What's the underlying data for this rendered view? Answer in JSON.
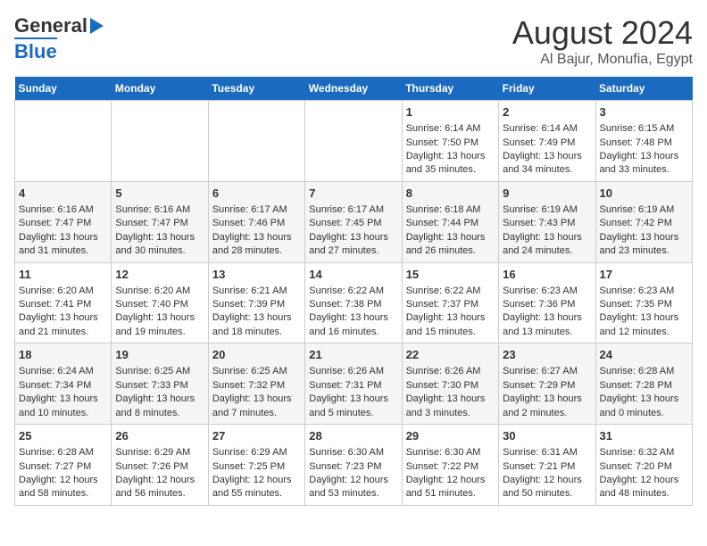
{
  "header": {
    "logo_line1": "General",
    "logo_line2": "Blue",
    "title": "August 2024",
    "subtitle": "Al Bajur, Monufia, Egypt"
  },
  "days_of_week": [
    "Sunday",
    "Monday",
    "Tuesday",
    "Wednesday",
    "Thursday",
    "Friday",
    "Saturday"
  ],
  "weeks": [
    [
      {
        "day": "",
        "info": ""
      },
      {
        "day": "",
        "info": ""
      },
      {
        "day": "",
        "info": ""
      },
      {
        "day": "",
        "info": ""
      },
      {
        "day": "1",
        "info": "Sunrise: 6:14 AM\nSunset: 7:50 PM\nDaylight: 13 hours and 35 minutes."
      },
      {
        "day": "2",
        "info": "Sunrise: 6:14 AM\nSunset: 7:49 PM\nDaylight: 13 hours and 34 minutes."
      },
      {
        "day": "3",
        "info": "Sunrise: 6:15 AM\nSunset: 7:48 PM\nDaylight: 13 hours and 33 minutes."
      }
    ],
    [
      {
        "day": "4",
        "info": "Sunrise: 6:16 AM\nSunset: 7:47 PM\nDaylight: 13 hours and 31 minutes."
      },
      {
        "day": "5",
        "info": "Sunrise: 6:16 AM\nSunset: 7:47 PM\nDaylight: 13 hours and 30 minutes."
      },
      {
        "day": "6",
        "info": "Sunrise: 6:17 AM\nSunset: 7:46 PM\nDaylight: 13 hours and 28 minutes."
      },
      {
        "day": "7",
        "info": "Sunrise: 6:17 AM\nSunset: 7:45 PM\nDaylight: 13 hours and 27 minutes."
      },
      {
        "day": "8",
        "info": "Sunrise: 6:18 AM\nSunset: 7:44 PM\nDaylight: 13 hours and 26 minutes."
      },
      {
        "day": "9",
        "info": "Sunrise: 6:19 AM\nSunset: 7:43 PM\nDaylight: 13 hours and 24 minutes."
      },
      {
        "day": "10",
        "info": "Sunrise: 6:19 AM\nSunset: 7:42 PM\nDaylight: 13 hours and 23 minutes."
      }
    ],
    [
      {
        "day": "11",
        "info": "Sunrise: 6:20 AM\nSunset: 7:41 PM\nDaylight: 13 hours and 21 minutes."
      },
      {
        "day": "12",
        "info": "Sunrise: 6:20 AM\nSunset: 7:40 PM\nDaylight: 13 hours and 19 minutes."
      },
      {
        "day": "13",
        "info": "Sunrise: 6:21 AM\nSunset: 7:39 PM\nDaylight: 13 hours and 18 minutes."
      },
      {
        "day": "14",
        "info": "Sunrise: 6:22 AM\nSunset: 7:38 PM\nDaylight: 13 hours and 16 minutes."
      },
      {
        "day": "15",
        "info": "Sunrise: 6:22 AM\nSunset: 7:37 PM\nDaylight: 13 hours and 15 minutes."
      },
      {
        "day": "16",
        "info": "Sunrise: 6:23 AM\nSunset: 7:36 PM\nDaylight: 13 hours and 13 minutes."
      },
      {
        "day": "17",
        "info": "Sunrise: 6:23 AM\nSunset: 7:35 PM\nDaylight: 13 hours and 12 minutes."
      }
    ],
    [
      {
        "day": "18",
        "info": "Sunrise: 6:24 AM\nSunset: 7:34 PM\nDaylight: 13 hours and 10 minutes."
      },
      {
        "day": "19",
        "info": "Sunrise: 6:25 AM\nSunset: 7:33 PM\nDaylight: 13 hours and 8 minutes."
      },
      {
        "day": "20",
        "info": "Sunrise: 6:25 AM\nSunset: 7:32 PM\nDaylight: 13 hours and 7 minutes."
      },
      {
        "day": "21",
        "info": "Sunrise: 6:26 AM\nSunset: 7:31 PM\nDaylight: 13 hours and 5 minutes."
      },
      {
        "day": "22",
        "info": "Sunrise: 6:26 AM\nSunset: 7:30 PM\nDaylight: 13 hours and 3 minutes."
      },
      {
        "day": "23",
        "info": "Sunrise: 6:27 AM\nSunset: 7:29 PM\nDaylight: 13 hours and 2 minutes."
      },
      {
        "day": "24",
        "info": "Sunrise: 6:28 AM\nSunset: 7:28 PM\nDaylight: 13 hours and 0 minutes."
      }
    ],
    [
      {
        "day": "25",
        "info": "Sunrise: 6:28 AM\nSunset: 7:27 PM\nDaylight: 12 hours and 58 minutes."
      },
      {
        "day": "26",
        "info": "Sunrise: 6:29 AM\nSunset: 7:26 PM\nDaylight: 12 hours and 56 minutes."
      },
      {
        "day": "27",
        "info": "Sunrise: 6:29 AM\nSunset: 7:25 PM\nDaylight: 12 hours and 55 minutes."
      },
      {
        "day": "28",
        "info": "Sunrise: 6:30 AM\nSunset: 7:23 PM\nDaylight: 12 hours and 53 minutes."
      },
      {
        "day": "29",
        "info": "Sunrise: 6:30 AM\nSunset: 7:22 PM\nDaylight: 12 hours and 51 minutes."
      },
      {
        "day": "30",
        "info": "Sunrise: 6:31 AM\nSunset: 7:21 PM\nDaylight: 12 hours and 50 minutes."
      },
      {
        "day": "31",
        "info": "Sunrise: 6:32 AM\nSunset: 7:20 PM\nDaylight: 12 hours and 48 minutes."
      }
    ]
  ]
}
